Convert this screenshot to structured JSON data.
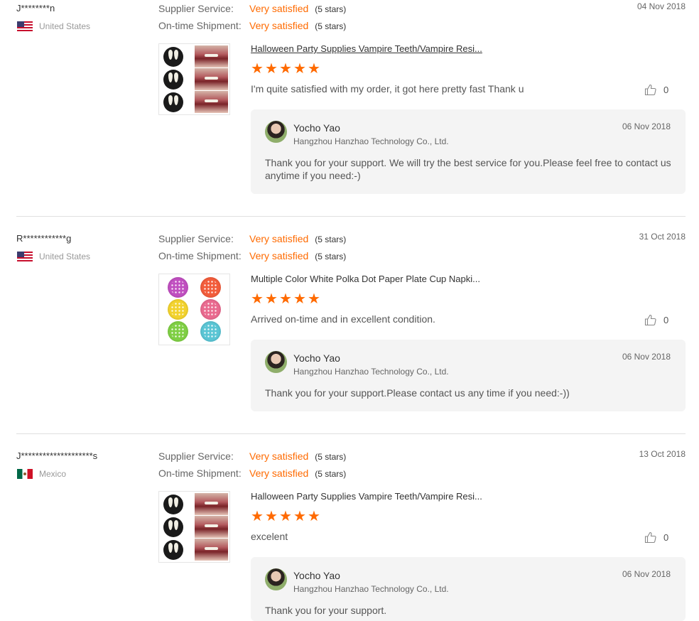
{
  "reviews": [
    {
      "buyer": "J********n",
      "country": "United States",
      "flag": "us",
      "supplier_service_label": "Supplier Service:",
      "supplier_service_value": "Very satisfied",
      "supplier_service_stars": "(5 stars)",
      "shipment_label": "On-time Shipment:",
      "shipment_value": "Very satisfied",
      "shipment_stars": "(5 stars)",
      "date": "04 Nov 2018",
      "product": "Halloween Party Supplies Vampire Teeth/Vampire Resi...",
      "rating": 5,
      "feedback": "I'm quite satisfied with my order, it got here pretty fast Thank u",
      "likes": "0",
      "reply": {
        "seller": "Yocho Yao",
        "company": "Hangzhou Hanzhao Technology Co., Ltd.",
        "date": "06 Nov 2018",
        "text": "Thank you for your support. We will try the best service for you.Please feel free to contact us anytime if you need:-)"
      }
    },
    {
      "buyer": "R************g",
      "country": "United States",
      "flag": "us",
      "supplier_service_label": "Supplier Service:",
      "supplier_service_value": "Very satisfied",
      "supplier_service_stars": "(5 stars)",
      "shipment_label": "On-time Shipment:",
      "shipment_value": "Very satisfied",
      "shipment_stars": "(5 stars)",
      "date": "31 Oct 2018",
      "product": "Multiple Color White Polka Dot Paper Plate Cup Napki...",
      "rating": 5,
      "feedback": "Arrived on-time and in excellent condition.",
      "likes": "0",
      "reply": {
        "seller": "Yocho Yao",
        "company": "Hangzhou Hanzhao Technology Co., Ltd.",
        "date": "06 Nov 2018",
        "text": "Thank you for your support.Please contact us any time if you need:-))"
      }
    },
    {
      "buyer": "J********************s",
      "country": "Mexico",
      "flag": "mx",
      "supplier_service_label": "Supplier Service:",
      "supplier_service_value": "Very satisfied",
      "supplier_service_stars": "(5 stars)",
      "shipment_label": "On-time Shipment:",
      "shipment_value": "Very satisfied",
      "shipment_stars": "(5 stars)",
      "date": "13 Oct 2018",
      "product": "Halloween Party Supplies Vampire Teeth/Vampire Resi...",
      "rating": 5,
      "feedback": "excelent",
      "likes": "0",
      "reply": {
        "seller": "Yocho Yao",
        "company": "Hangzhou Hanzhao Technology Co., Ltd.",
        "date": "06 Nov 2018",
        "text": "Thank you for your support."
      }
    }
  ],
  "colors": {
    "accent": "#ff6a00",
    "plate_colors": [
      "#c04fc0",
      "#f25c3b",
      "#f2d22e",
      "#e96a8f",
      "#7fcf44",
      "#5ac5d4"
    ]
  }
}
